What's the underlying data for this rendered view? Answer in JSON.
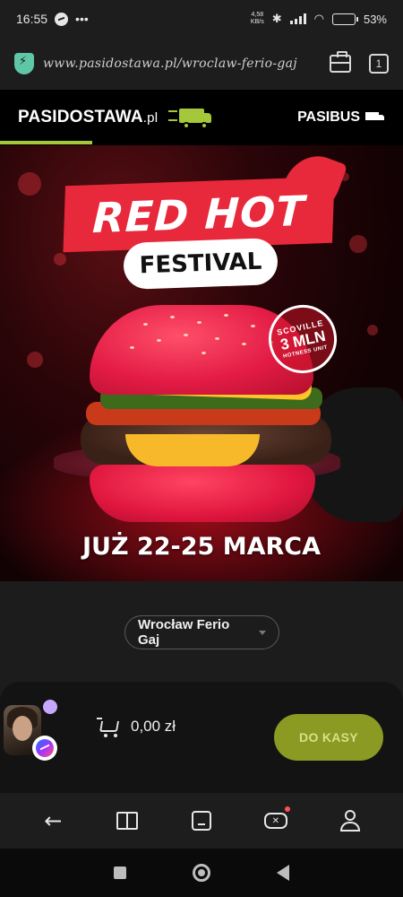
{
  "status_bar": {
    "time": "16:55",
    "more_dots": "•••",
    "speed_value": "4,58",
    "speed_unit": "KB/s",
    "battery_text": "53%",
    "battery_level": 0.53
  },
  "browser": {
    "url": "www.pasidostawa.pl/wroclaw-ferio-gaj",
    "tab_count": "1"
  },
  "site_header": {
    "brand": "PASIDOSTAWA",
    "brand_suffix": ".pl",
    "pasibus_label": "PASIBUS"
  },
  "banner": {
    "title": "RED HOT",
    "subtitle": "FESTIVAL",
    "badge_top": "SCOVILLE",
    "badge_value": "3 MLN",
    "badge_bottom": "HOTNESS UNIT",
    "date_text": "JUŻ 22-25 MARCA"
  },
  "location": {
    "selected": "Wrocław Ferio Gaj"
  },
  "cart": {
    "total": "0,00 zł",
    "checkout_label": "DO KASY"
  },
  "colors": {
    "accent_green": "#a5c83a",
    "checkout_green": "#8a9a22",
    "festival_red": "#e8283b"
  },
  "icons": {
    "browser_nav": [
      "back-arrow-icon",
      "book-icon",
      "home-icon",
      "gamepad-icon",
      "profile-icon"
    ],
    "system_nav": [
      "recents-icon",
      "home-circle-icon",
      "back-triangle-icon"
    ]
  }
}
